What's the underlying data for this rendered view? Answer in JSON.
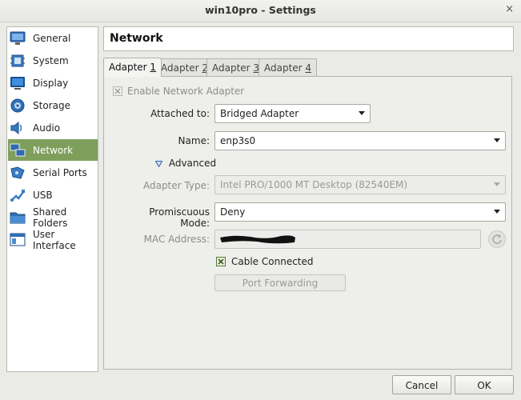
{
  "window": {
    "title": "win10pro - Settings",
    "close_glyph": "×"
  },
  "sidebar": {
    "items": [
      {
        "label": "General",
        "icon": "general-icon"
      },
      {
        "label": "System",
        "icon": "system-icon"
      },
      {
        "label": "Display",
        "icon": "display-icon"
      },
      {
        "label": "Storage",
        "icon": "storage-icon"
      },
      {
        "label": "Audio",
        "icon": "audio-icon"
      },
      {
        "label": "Network",
        "icon": "network-icon"
      },
      {
        "label": "Serial Ports",
        "icon": "serial-ports-icon"
      },
      {
        "label": "USB",
        "icon": "usb-icon"
      },
      {
        "label": "Shared Folders",
        "icon": "shared-folders-icon"
      },
      {
        "label": "User Interface",
        "icon": "user-interface-icon"
      }
    ],
    "active": "Network"
  },
  "page": {
    "title": "Network"
  },
  "tabs": [
    {
      "label": "Adapter ",
      "key": "1"
    },
    {
      "label": "Adapter ",
      "key": "2"
    },
    {
      "label": "Adapter ",
      "key": "3"
    },
    {
      "label": "Adapter ",
      "key": "4"
    }
  ],
  "form": {
    "enable_adapter": {
      "label": "Enable Network Adapter",
      "checked": true
    },
    "attached_to": {
      "label": "Attached to:",
      "value": "Bridged Adapter"
    },
    "name": {
      "label": "Name:",
      "value": "enp3s0"
    },
    "advanced": {
      "label": "Advanced"
    },
    "adapter_type": {
      "label": "Adapter Type:",
      "value": "Intel PRO/1000 MT Desktop (82540EM)"
    },
    "promiscuous": {
      "label": "Promiscuous Mode:",
      "value": "Deny"
    },
    "mac": {
      "label": "MAC Address:",
      "value": ""
    },
    "cable": {
      "label": "Cable Connected",
      "checked": true
    },
    "port_forwarding": {
      "label": "Port Forwarding"
    }
  },
  "footer": {
    "cancel_label": "Cancel",
    "ok_label": "OK"
  },
  "colors": {
    "accent": "#7e9f5b",
    "background": "#eaeae6"
  }
}
